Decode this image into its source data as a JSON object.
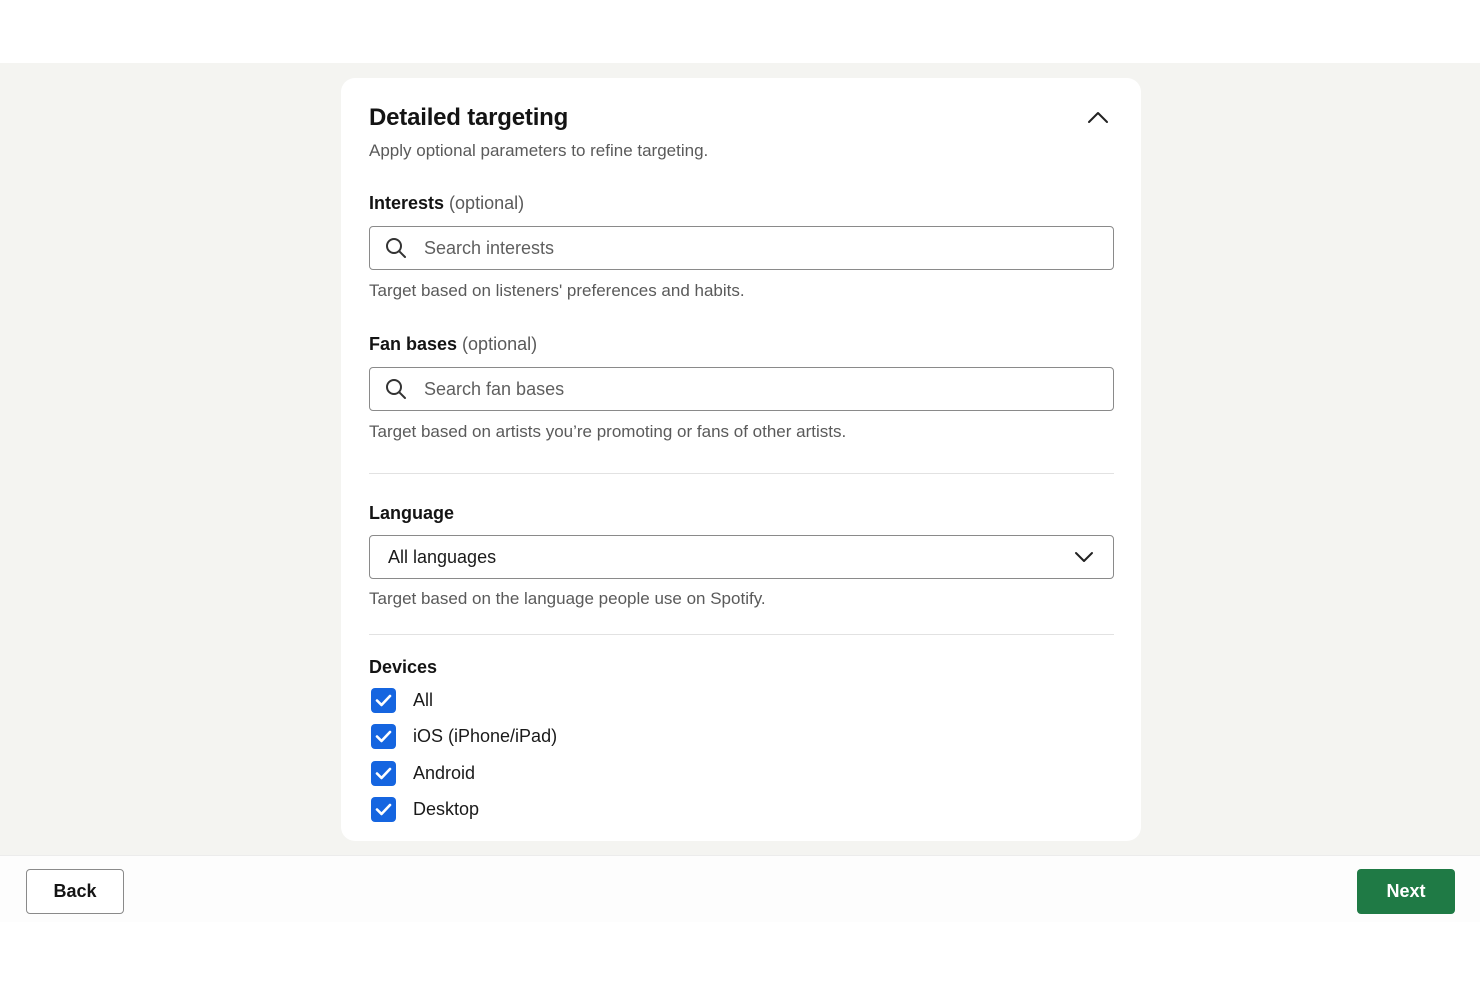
{
  "panel": {
    "title": "Detailed targeting",
    "subtitle": "Apply optional parameters to refine targeting.",
    "collapse_icon": "chevron-up-icon"
  },
  "interests": {
    "label": "Interests",
    "optional": "(optional)",
    "placeholder": "Search interests",
    "value": "",
    "help": "Target based on listeners' preferences and habits.",
    "icon": "search-icon"
  },
  "fan_bases": {
    "label": "Fan bases",
    "optional": "(optional)",
    "placeholder": "Search fan bases",
    "value": "",
    "help": "Target based on artists you’re promoting or fans of other artists.",
    "icon": "search-icon"
  },
  "language": {
    "label": "Language",
    "selected": "All languages",
    "help": "Target based on the language people use on Spotify.",
    "icon": "chevron-down-icon"
  },
  "devices": {
    "label": "Devices",
    "options": [
      {
        "label": "All",
        "checked": true
      },
      {
        "label": "iOS (iPhone/iPad)",
        "checked": true
      },
      {
        "label": "Android",
        "checked": true
      },
      {
        "label": "Desktop",
        "checked": true
      }
    ]
  },
  "footer": {
    "back_label": "Back",
    "next_label": "Next"
  },
  "colors": {
    "page_background": "#f4f4f1",
    "checkbox": "#1565e0",
    "next_button": "#1f7a45"
  }
}
